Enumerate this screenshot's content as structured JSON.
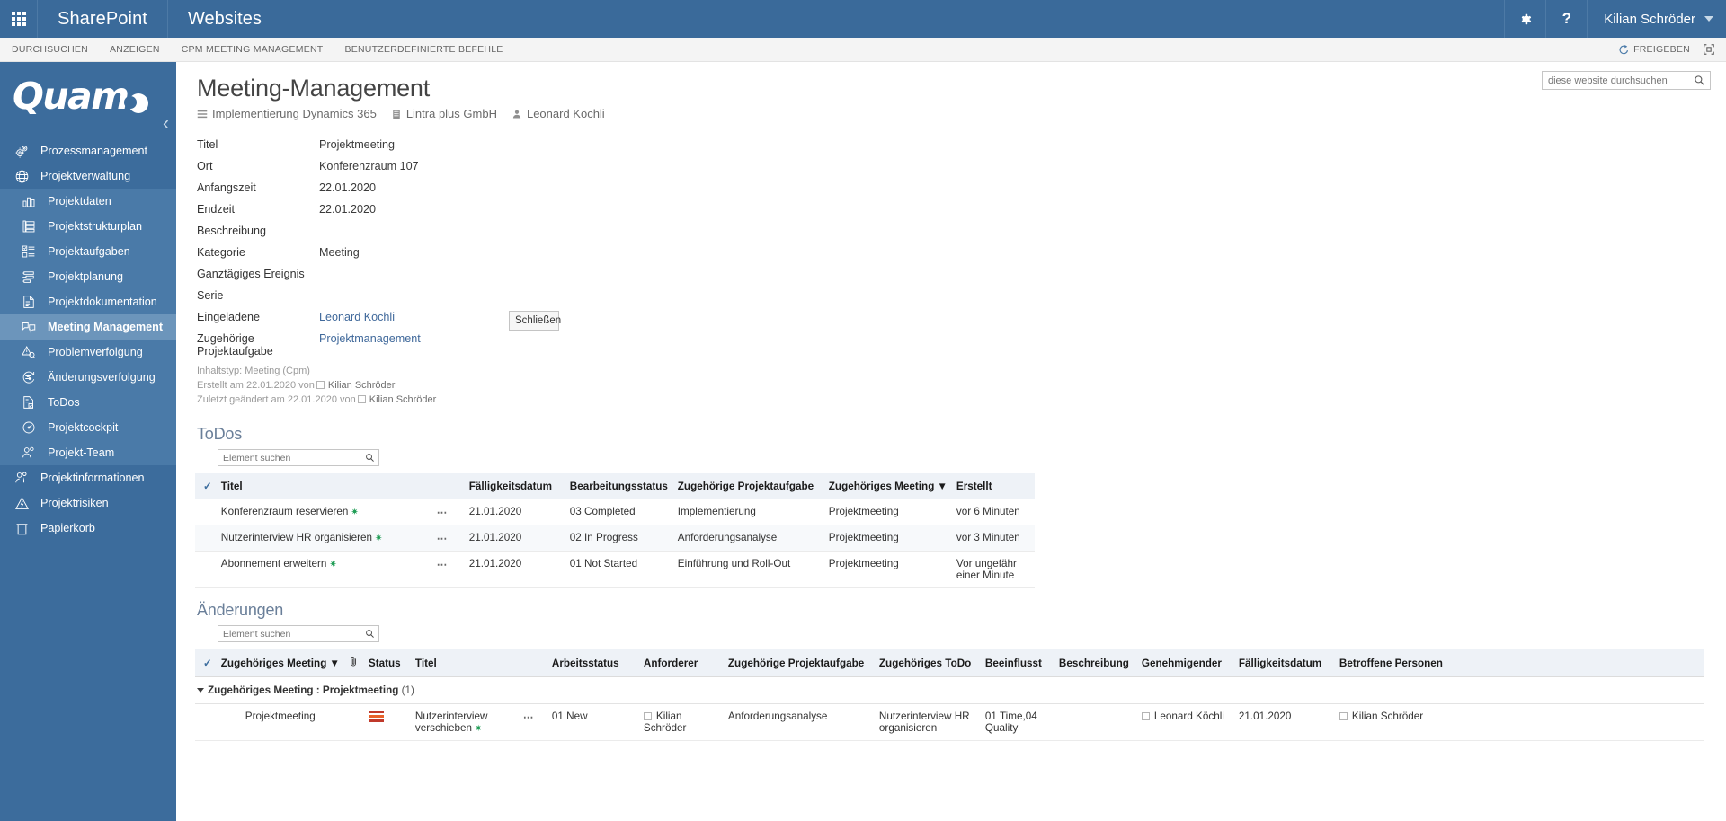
{
  "suite": {
    "waffle_icon": "waffle-grid-icon",
    "brand": "SharePoint",
    "site": "Websites",
    "settings_icon": "gear-icon",
    "help_icon": "question-mark-icon",
    "user": "Kilian Schröder",
    "user_caret_icon": "chevron-down-icon"
  },
  "ribbon": {
    "tabs": [
      "DURCHSUCHEN",
      "ANZEIGEN",
      "CPM MEETING MANAGEMENT",
      "BENUTZERDEFINIERTE BEFEHLE"
    ],
    "share_label": "FREIGEBEN",
    "share_icon": "share-icon",
    "focus_icon": "focus-on-content-icon"
  },
  "sidebar": {
    "logo_text": "Quam",
    "logo_mark_icon": "quam-crescent-icon",
    "collapse_icon": "chevron-left-icon",
    "items": [
      {
        "label": "Prozessmanagement",
        "icon": "gears-icon",
        "level": "top",
        "active": false
      },
      {
        "label": "Projektverwaltung",
        "icon": "globe-icon",
        "level": "top",
        "active": false
      },
      {
        "label": "Projektdaten",
        "icon": "bar-chart-icon",
        "level": "sub",
        "active": false
      },
      {
        "label": "Projektstrukturplan",
        "icon": "structure-icon",
        "level": "sub",
        "active": false
      },
      {
        "label": "Projektaufgaben",
        "icon": "task-list-icon",
        "level": "sub",
        "active": false
      },
      {
        "label": "Projektplanung",
        "icon": "gantt-icon",
        "level": "sub",
        "active": false
      },
      {
        "label": "Projektdokumentation",
        "icon": "document-icon",
        "level": "sub",
        "active": false
      },
      {
        "label": "Meeting Management",
        "icon": "meeting-chat-icon",
        "level": "sub",
        "active": true
      },
      {
        "label": "Problemverfolgung",
        "icon": "warning-search-icon",
        "level": "sub",
        "active": false
      },
      {
        "label": "Änderungsverfolgung",
        "icon": "change-tracking-icon",
        "level": "sub",
        "active": false
      },
      {
        "label": "ToDos",
        "icon": "checklist-icon",
        "level": "sub",
        "active": false
      },
      {
        "label": "Projektcockpit",
        "icon": "gauge-icon",
        "level": "sub",
        "active": false
      },
      {
        "label": "Projekt-Team",
        "icon": "people-icon",
        "level": "sub",
        "active": false
      },
      {
        "label": "Projektinformationen",
        "icon": "people-info-icon",
        "level": "top",
        "active": false
      },
      {
        "label": "Projektrisiken",
        "icon": "risk-warning-icon",
        "level": "top",
        "active": false
      },
      {
        "label": "Papierkorb",
        "icon": "trash-icon",
        "level": "top",
        "active": false
      }
    ]
  },
  "search": {
    "placeholder": "diese website durchsuchen",
    "value": "",
    "icon": "search-icon"
  },
  "page": {
    "title": "Meeting-Management",
    "breadcrumb": [
      {
        "label": "Implementierung Dynamics 365",
        "icon": "list-icon"
      },
      {
        "label": "Lintra plus GmbH",
        "icon": "building-icon"
      },
      {
        "label": "Leonard Köchli",
        "icon": "person-icon"
      }
    ]
  },
  "detail": {
    "fields": [
      {
        "label": "Titel",
        "value": "Projektmeeting",
        "link": false
      },
      {
        "label": "Ort",
        "value": "Konferenzraum 107",
        "link": false
      },
      {
        "label": "Anfangszeit",
        "value": "22.01.2020",
        "link": false
      },
      {
        "label": "Endzeit",
        "value": "22.01.2020",
        "link": false
      },
      {
        "label": "Beschreibung",
        "value": "",
        "link": false
      },
      {
        "label": "Kategorie",
        "value": "Meeting",
        "link": false
      },
      {
        "label": "Ganztägiges Ereignis",
        "value": "",
        "link": false
      },
      {
        "label": "Serie",
        "value": "",
        "link": false
      },
      {
        "label": "Eingeladene",
        "value": "Leonard Köchli",
        "link": true
      },
      {
        "label": "Zugehörige Projektaufgabe",
        "value": "Projektmanagement",
        "link": true
      }
    ],
    "content_type": "Inhaltstyp: Meeting (Cpm)",
    "created_prefix": "Erstellt am 22.01.2020 von",
    "created_by": "Kilian Schröder",
    "modified_prefix": "Zuletzt geändert am 22.01.2020 von",
    "modified_by": "Kilian Schröder",
    "close_label": "Schließen"
  },
  "todos": {
    "title": "ToDos",
    "search_placeholder": "Element suchen",
    "search_value": "",
    "search_icon": "search-icon",
    "check_all_icon": "checkmark-icon",
    "columns": [
      "Titel",
      "Fälligkeitsdatum",
      "Bearbeitungsstatus",
      "Zugehörige Projektaufgabe",
      "Zugehöriges Meeting",
      "Erstellt"
    ],
    "sorted_column": "Zugehöriges Meeting",
    "sort_icon": "filter-icon",
    "rows": [
      {
        "titel": "Konferenzraum reservieren",
        "new_badge": "✷",
        "menu_icon": "ellipsis-icon",
        "faelligkeitsdatum": "21.01.2020",
        "bearbeitungsstatus": "03 Completed",
        "projektaufgabe": "Implementierung",
        "meeting": "Projektmeeting",
        "erstellt": "vor 6 Minuten"
      },
      {
        "titel": "Nutzerinterview HR organisieren",
        "new_badge": "✷",
        "menu_icon": "ellipsis-icon",
        "faelligkeitsdatum": "21.01.2020",
        "bearbeitungsstatus": "02 In Progress",
        "projektaufgabe": "Anforderungsanalyse",
        "meeting": "Projektmeeting",
        "erstellt": "vor 3 Minuten"
      },
      {
        "titel": "Abonnement erweitern",
        "new_badge": "✷",
        "menu_icon": "ellipsis-icon",
        "faelligkeitsdatum": "21.01.2020",
        "bearbeitungsstatus": "01 Not Started",
        "projektaufgabe": "Einführung und Roll-Out",
        "meeting": "Projektmeeting",
        "erstellt": "Vor ungefähr einer Minute"
      }
    ]
  },
  "aenderungen": {
    "title": "Änderungen",
    "search_placeholder": "Element suchen",
    "search_value": "",
    "search_icon": "search-icon",
    "check_all_icon": "checkmark-icon",
    "attachment_icon": "paperclip-icon",
    "sort_icon": "filter-icon",
    "columns": [
      "Zugehöriges Meeting",
      "Status",
      "Titel",
      "Arbeitsstatus",
      "Anforderer",
      "Zugehörige Projektaufgabe",
      "Zugehöriges ToDo",
      "Beeinflusst",
      "Beschreibung",
      "Genehmigender",
      "Fälligkeitsdatum",
      "Betroffene Personen"
    ],
    "group_label": "Zugehöriges Meeting : Projektmeeting",
    "group_count": "(1)",
    "group_toggle_icon": "triangle-collapse-icon",
    "rows": [
      {
        "meeting": "Projektmeeting",
        "status_icon": "status-bars-icon",
        "titel": "Nutzerinterview verschieben",
        "new_badge": "✷",
        "menu_icon": "ellipsis-icon",
        "arbeitsstatus": "01 New",
        "anforderer": "Kilian Schröder",
        "projektaufgabe": "Anforderungsanalyse",
        "todo": "Nutzerinterview HR organisieren",
        "beeinflusst": "01 Time,04 Quality",
        "beschreibung": "",
        "genehmigender": "Leonard Köchli",
        "faelligkeitsdatum": "21.01.2020",
        "betroffene_personen": "Kilian Schröder"
      }
    ]
  },
  "colors": {
    "suite_bar": "#3a6a9a",
    "sidebar": "#3c6c9c",
    "sidebar_sub": "#4a7aa8",
    "sidebar_active": "#6c95bb",
    "link": "#40699b",
    "table_header": "#eef2f7",
    "status_red": "#c0392b",
    "status_orange": "#e8622a",
    "new_badge_green": "#1f9d55"
  }
}
